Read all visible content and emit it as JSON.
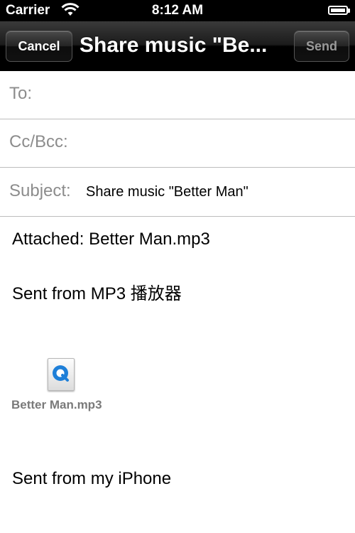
{
  "status_bar": {
    "carrier": "Carrier",
    "time": "8:12 AM"
  },
  "nav_bar": {
    "cancel_label": "Cancel",
    "title": "Share music \"Be...",
    "send_label": "Send"
  },
  "fields": {
    "to_label": "To:",
    "ccbcc_label": "Cc/Bcc:",
    "subject_label": "Subject:",
    "subject_value": "Share music \"Better Man\""
  },
  "body": {
    "attached_line": "Attached: Better Man.mp3",
    "sent_from_app": "Sent from MP3 播放器",
    "attachment_name": "Better Man.mp3",
    "attachment_icon": "quicktime-audio-icon",
    "signature": "Sent from my iPhone"
  },
  "colors": {
    "nav_bar": "#000000",
    "label_gray": "#8c8c8c",
    "quicktime_blue": "#1e7fd8"
  }
}
